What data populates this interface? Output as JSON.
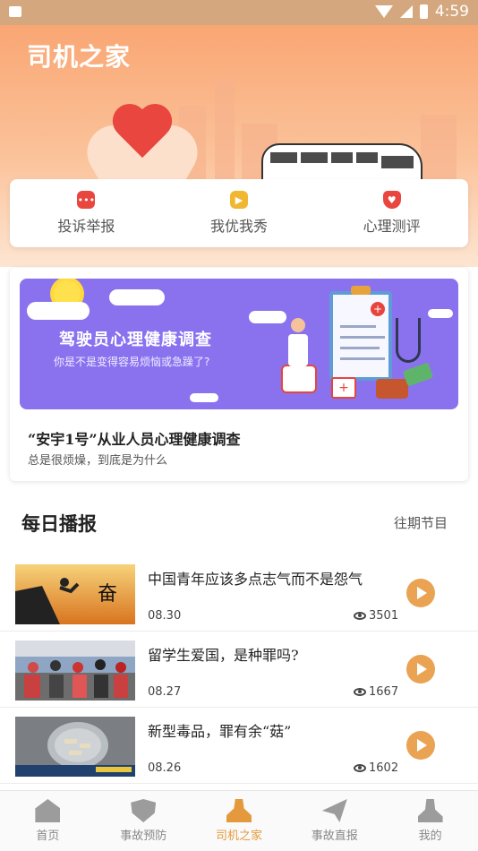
{
  "status_bar": {
    "time": "4:59"
  },
  "header": {
    "title": "司机之家"
  },
  "quick_actions": [
    {
      "label": "投诉举报",
      "icon": "chat-icon",
      "color": "#e8463f"
    },
    {
      "label": "我优我秀",
      "icon": "play-video-icon",
      "color": "#f1b731"
    },
    {
      "label": "心理测评",
      "icon": "heart-shield-icon",
      "color": "#e8463f"
    }
  ],
  "survey": {
    "banner_title": "驾驶员心理健康调查",
    "banner_subtitle": "你是不是变得容易烦恼或急躁了?",
    "title": "“安宇1号”从业人员心理健康调查",
    "subtitle": "总是很烦燥，到底是为什么"
  },
  "daily": {
    "title": "每日播报",
    "more_label": "往期节目",
    "items": [
      {
        "title": "中国青年应该多点志气而不是怨气",
        "date": "08.30",
        "views": "3501"
      },
      {
        "title": "留学生爱国，是种罪吗?",
        "date": "08.27",
        "views": "1667"
      },
      {
        "title": "新型毒品，罪有余“菇”",
        "date": "08.26",
        "views": "1602"
      }
    ]
  },
  "tabs": [
    {
      "label": "首页",
      "icon": "home-icon",
      "active": false
    },
    {
      "label": "事故预防",
      "icon": "shield-check-icon",
      "active": false
    },
    {
      "label": "司机之家",
      "icon": "driver-icon",
      "active": true
    },
    {
      "label": "事故直报",
      "icon": "paper-plane-icon",
      "active": false
    },
    {
      "label": "我的",
      "icon": "user-icon",
      "active": false
    }
  ],
  "colors": {
    "accent": "#e49a3c",
    "hero_top": "#f9a673",
    "banner": "#8a72ef",
    "play": "#eaa253"
  }
}
